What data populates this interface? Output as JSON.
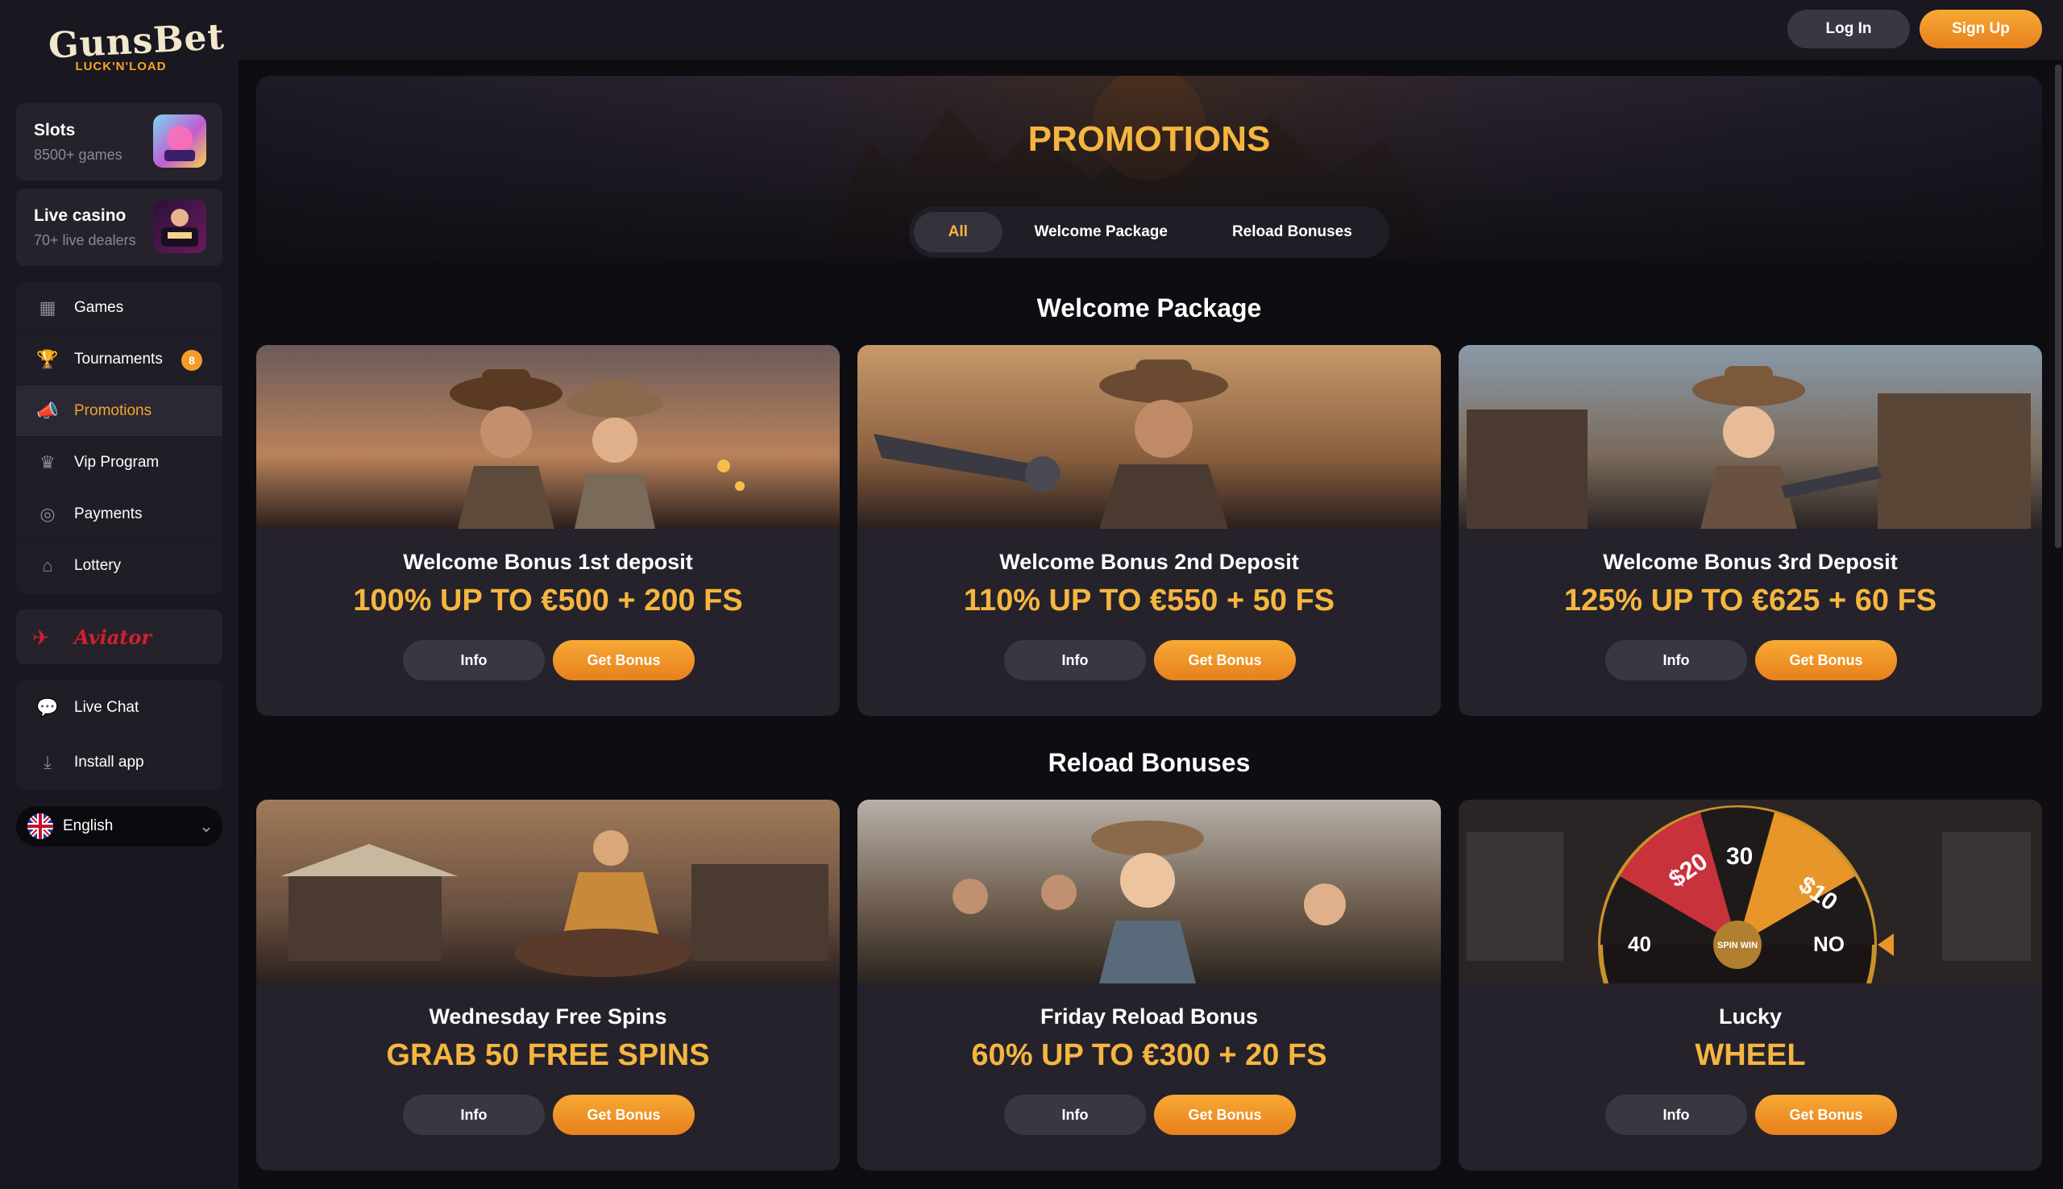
{
  "brand": {
    "name": "GunsBet",
    "tagline": "LUCK'N'LOAD",
    "accent": "#f5b63f",
    "button_color": "#f39a29"
  },
  "sidebar": {
    "categories": [
      {
        "title": "Slots",
        "subtitle": "8500+ games",
        "icon": "slots-thumbnail"
      },
      {
        "title": "Live casino",
        "subtitle": "70+ live dealers",
        "icon": "live-casino-thumbnail"
      }
    ],
    "nav": [
      {
        "label": "Games",
        "icon": "games-icon"
      },
      {
        "label": "Tournaments",
        "icon": "trophy-icon",
        "badge": "8"
      },
      {
        "label": "Promotions",
        "icon": "megaphone-icon",
        "active": true
      },
      {
        "label": "Vip Program",
        "icon": "vip-icon"
      },
      {
        "label": "Payments",
        "icon": "payments-icon"
      },
      {
        "label": "Lottery",
        "icon": "lottery-icon"
      }
    ],
    "aviator": {
      "label": "Aviator",
      "icon": "plane-icon"
    },
    "support": [
      {
        "label": "Live Chat",
        "icon": "chat-icon"
      },
      {
        "label": "Install app",
        "icon": "download-icon"
      }
    ],
    "language": {
      "label": "English",
      "icon": "uk-flag-icon"
    }
  },
  "header": {
    "login": "Log In",
    "signup": "Sign Up"
  },
  "hero": {
    "title": "PROMOTIONS"
  },
  "tabs": [
    {
      "label": "All",
      "active": true
    },
    {
      "label": "Welcome Package"
    },
    {
      "label": "Reload Bonuses"
    }
  ],
  "sections": [
    {
      "title": "Welcome Package",
      "cards": [
        {
          "title": "Welcome Bonus 1st deposit",
          "offer": "100% UP TO €500 + 200 FS",
          "info": "Info",
          "cta": "Get Bonus"
        },
        {
          "title": "Welcome Bonus 2nd Deposit",
          "offer": "110% UP TO €550 + 50 FS",
          "info": "Info",
          "cta": "Get Bonus"
        },
        {
          "title": "Welcome Bonus 3rd Deposit",
          "offer": "125% UP TO €625 + 60 FS",
          "info": "Info",
          "cta": "Get Bonus"
        }
      ]
    },
    {
      "title": "Reload Bonuses",
      "cards": [
        {
          "title": "Wednesday Free Spins",
          "offer": "GRAB 50 FREE SPINS",
          "info": "Info",
          "cta": "Get Bonus"
        },
        {
          "title": "Friday Reload Bonus",
          "offer": "60% UP TO €300 + 20 FS",
          "info": "Info",
          "cta": "Get Bonus"
        },
        {
          "title": "Lucky",
          "offer": "WHEEL",
          "info": "Info",
          "cta": "Get Bonus"
        }
      ]
    }
  ],
  "wheel": {
    "segments": [
      "$20",
      "30",
      "$10",
      "40",
      "NO"
    ],
    "center": "SPIN WIN"
  }
}
